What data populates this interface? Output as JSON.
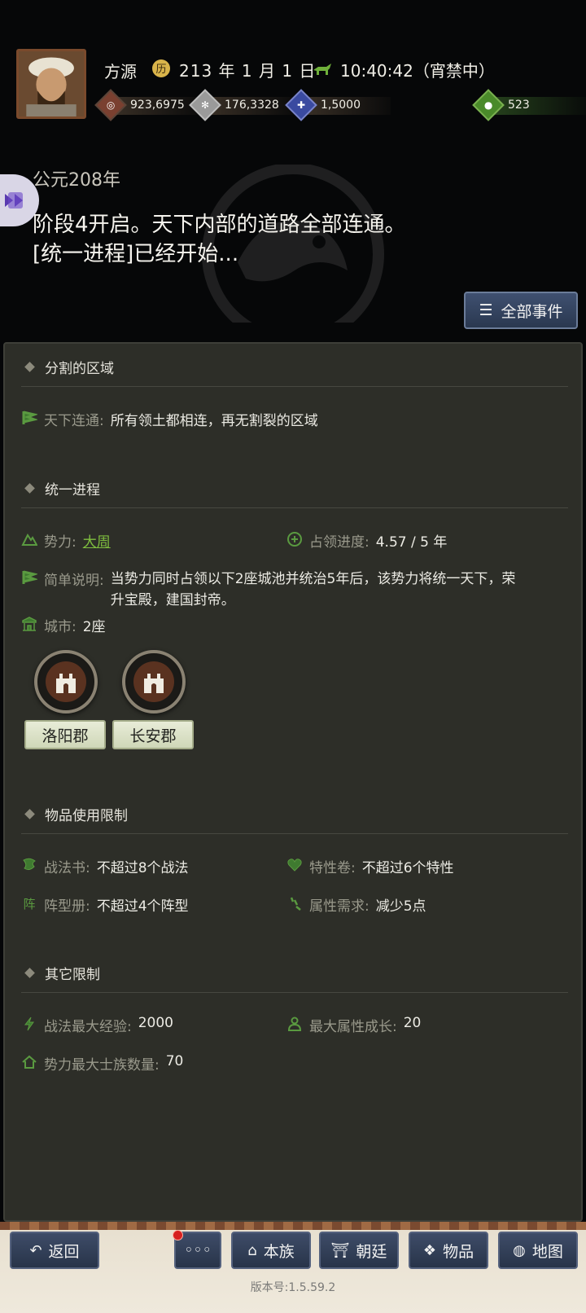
{
  "header": {
    "player_name": "方源",
    "date": "213 年 1 月 1 日",
    "time": "10:40:42（宵禁中）",
    "resources": [
      {
        "icon": "copper-coin-icon",
        "value": "923,6975",
        "color": "#7a4030"
      },
      {
        "icon": "grain-icon",
        "value": "176,3328",
        "color": "#9a9a9a"
      },
      {
        "icon": "troops-icon",
        "value": "1,5000",
        "color": "#3a4aa0"
      },
      {
        "icon": "money-bag-icon",
        "value": "523",
        "color": "#4a8a2a"
      }
    ],
    "era_title": "公元208年",
    "notice_line1": "阶段4开启。天下内部的道路全部连通。",
    "notice_line2": "[统一进程]已经开始...",
    "all_events_button": "全部事件"
  },
  "sections": {
    "divided": {
      "title": "分割的区域",
      "connect_label": "天下连通:",
      "connect_value": "所有领土都相连，再无割裂的区域"
    },
    "unify": {
      "title": "统一进程",
      "force_label": "势力:",
      "force_value": "大周",
      "progress_label": "占领进度:",
      "progress_value": "4.57 / 5 年",
      "desc_label": "简单说明:",
      "desc_value": "当势力同时占领以下2座城池并统治5年后，该势力将统一天下，荣升宝殿，建国封帝。",
      "city_label": "城市:",
      "city_value": "2座",
      "cities": [
        "洛阳郡",
        "长安郡"
      ]
    },
    "items": {
      "title": "物品使用限制",
      "tactics_label": "战法书:",
      "tactics_value": "不超过8个战法",
      "trait_label": "特性卷:",
      "trait_value": "不超过6个特性",
      "formation_label": "阵型册:",
      "formation_value": "不超过4个阵型",
      "attr_label": "属性需求:",
      "attr_value": "减少5点"
    },
    "other": {
      "title": "其它限制",
      "exp_label": "战法最大经验:",
      "exp_value": "2000",
      "growth_label": "最大属性成长:",
      "growth_value": "20",
      "clan_label": "势力最大士族数量:",
      "clan_value": "70"
    }
  },
  "bottom_nav": {
    "back": "返回",
    "more": "◦◦◦",
    "clan": "本族",
    "court": "朝廷",
    "items": "物品",
    "map": "地图",
    "version": "版本号:1.5.59.2"
  }
}
